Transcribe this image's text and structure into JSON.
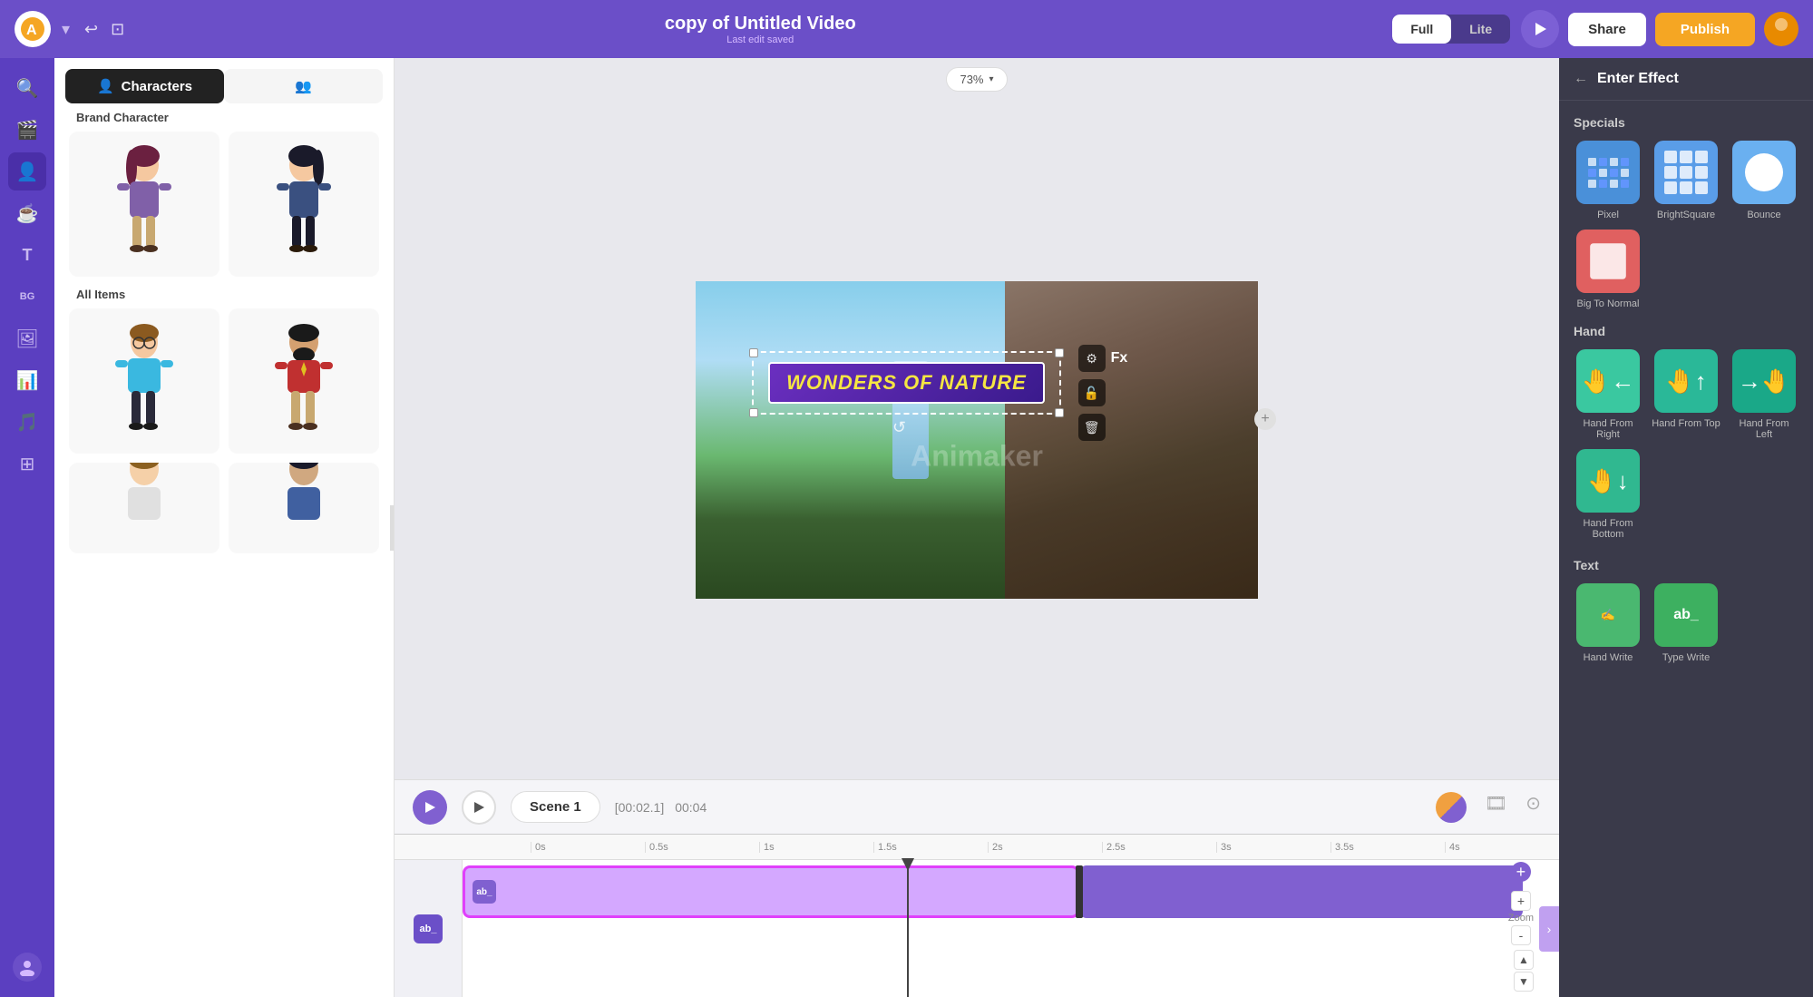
{
  "app": {
    "title": "copy of Untitled Video",
    "subtitle": "Last edit saved",
    "logo_text": "A"
  },
  "topbar": {
    "full_label": "Full",
    "lite_label": "Lite",
    "share_label": "Share",
    "publish_label": "Publish",
    "zoom_label": "73%"
  },
  "left_panel": {
    "characters_tab": "Characters",
    "brand_character_title": "Brand Character",
    "all_items_title": "All Items"
  },
  "canvas": {
    "video_title": "WONDERS OF NATURE",
    "watermark": "Animaker"
  },
  "timeline": {
    "scene_label": "Scene 1",
    "duration": "[00:02.1]",
    "time": "00:04",
    "marks": [
      "0s",
      "0.5s",
      "1s",
      "1.5s",
      "2s",
      "2.5s",
      "3s",
      "3.5s",
      "4s"
    ],
    "zoom_label": "Zoom"
  },
  "right_panel": {
    "title": "Enter Effect",
    "back_label": "←",
    "specials_title": "Specials",
    "hand_title": "Hand",
    "text_title": "Text",
    "effects": {
      "specials": [
        {
          "label": "Pixel",
          "type": "pixel"
        },
        {
          "label": "BrightSquare",
          "type": "bright"
        },
        {
          "label": "Bounce",
          "type": "bounce"
        },
        {
          "label": "Big To Normal",
          "type": "bignormal"
        }
      ],
      "hand": [
        {
          "label": "Hand From Right",
          "type": "hand-right"
        },
        {
          "label": "Hand From Top",
          "type": "hand-top"
        },
        {
          "label": "Hand From Left",
          "type": "hand-left"
        },
        {
          "label": "Hand From Bottom",
          "type": "hand-bottom"
        }
      ],
      "text": [
        {
          "label": "Hand Write",
          "type": "handwrite"
        },
        {
          "label": "Type Write",
          "type": "typewrite"
        }
      ]
    }
  }
}
